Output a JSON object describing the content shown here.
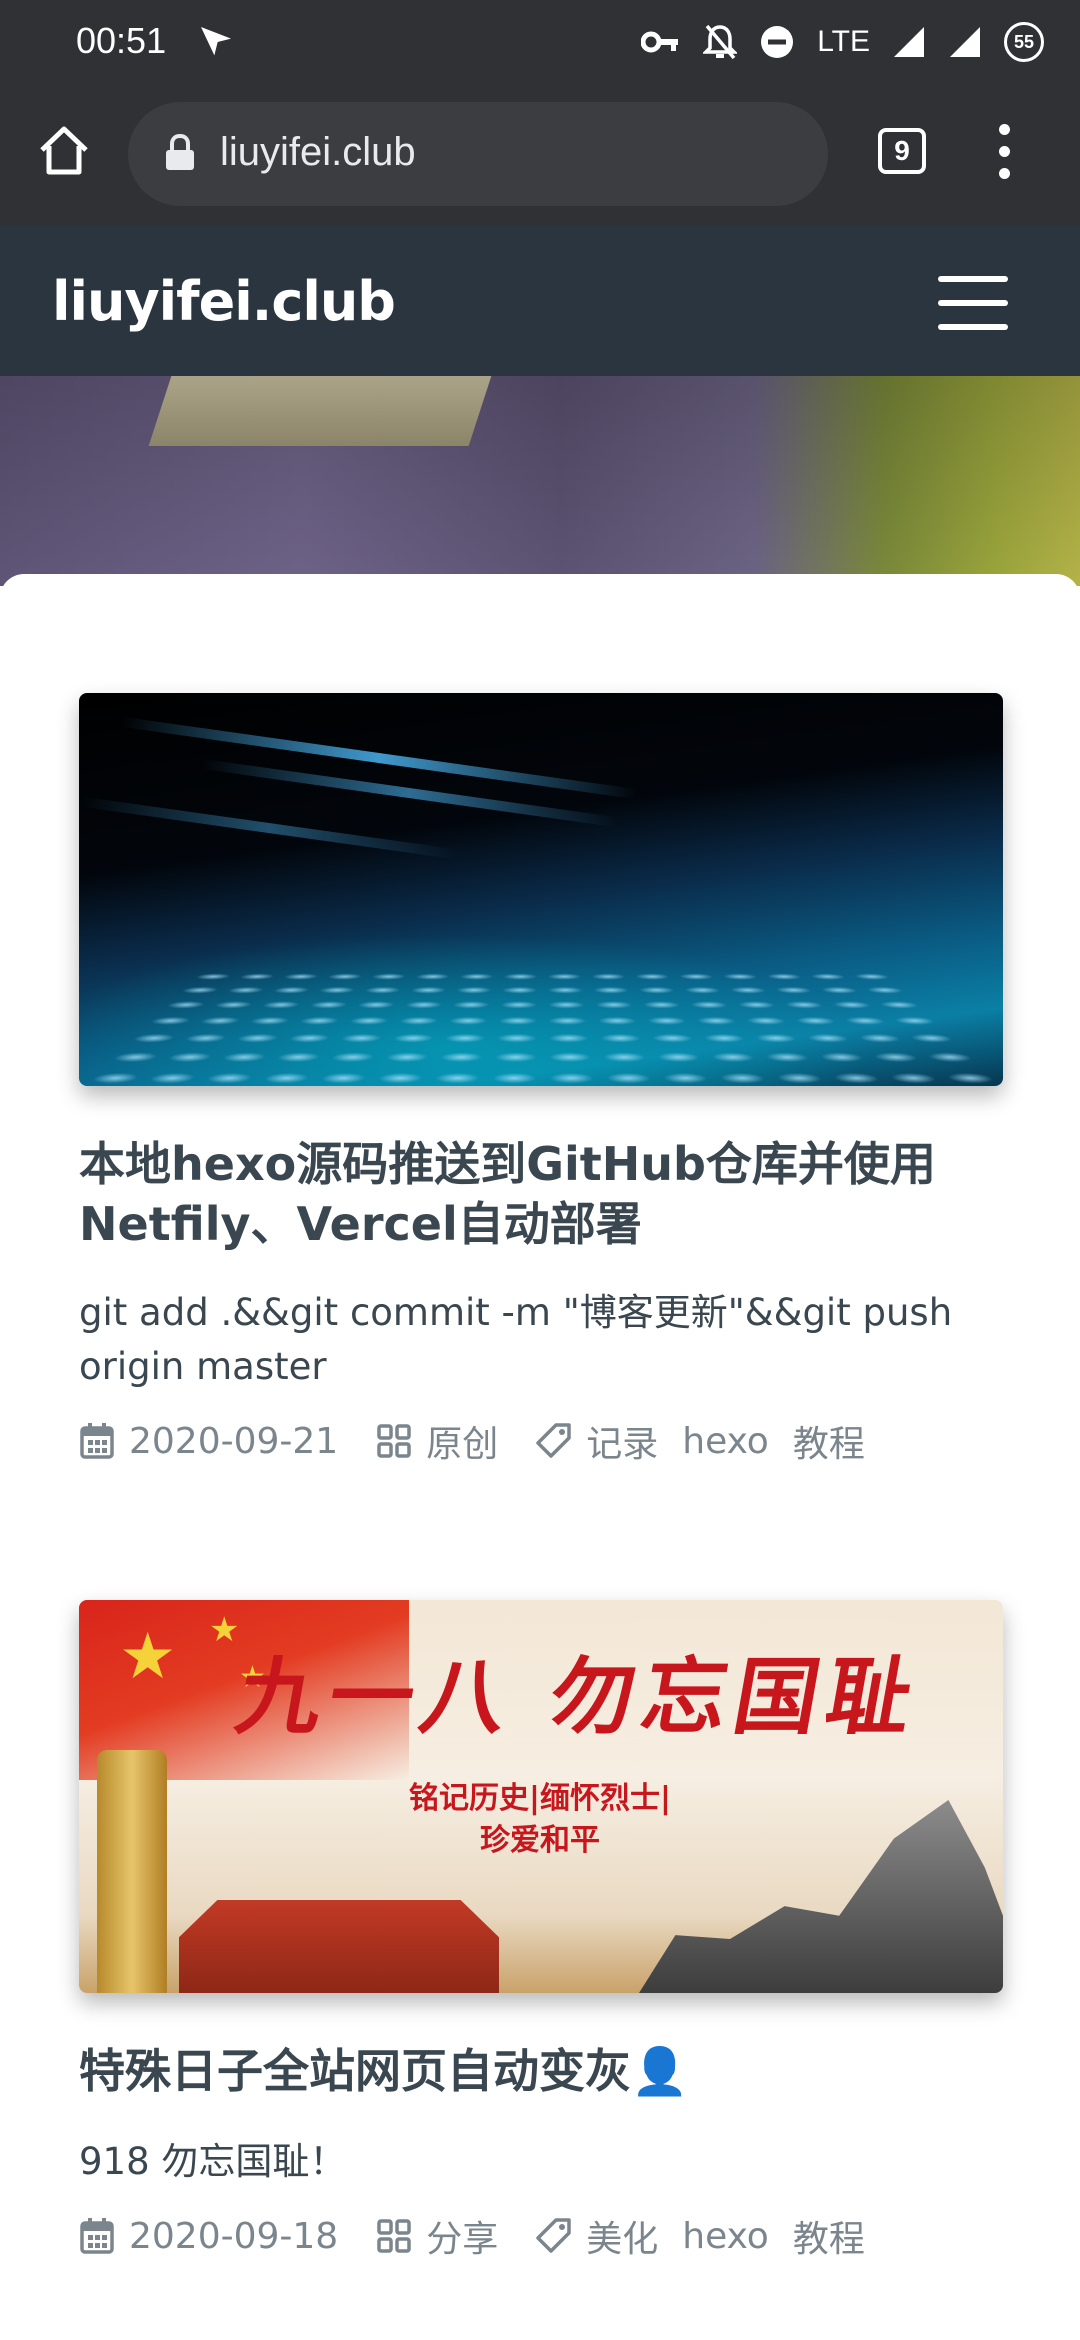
{
  "status_bar": {
    "time": "00:51",
    "network": "LTE",
    "battery": "55"
  },
  "browser": {
    "url": "liuyifei.club",
    "tab_count": "9"
  },
  "site": {
    "title": "liuyifei.club"
  },
  "posts": [
    {
      "image": "keyboard-photo",
      "title": "本地hexo源码推送到GitHub仓库并使用Netfily、Vercel自动部署",
      "excerpt": "git add .&&git commit -m \"博客更新\"&&git push origin master",
      "date": "2020-09-21",
      "category": "原创",
      "tags": [
        "记录",
        "hexo",
        "教程"
      ]
    },
    {
      "image": "memorial-banner",
      "image_text": {
        "headline": "九一八 勿忘国耻",
        "sub_line_1": "铭记历史|缅怀烈士|",
        "sub_line_2": "珍爱和平"
      },
      "title": "特殊日子全站网页自动变灰👤",
      "excerpt": "918 勿忘国耻！",
      "date": "2020-09-18",
      "category": "分享",
      "tags": [
        "美化",
        "hexo",
        "教程"
      ]
    }
  ],
  "icons": {
    "date": "calendar-icon",
    "category": "category-grid-icon",
    "tags": "tag-icon"
  }
}
